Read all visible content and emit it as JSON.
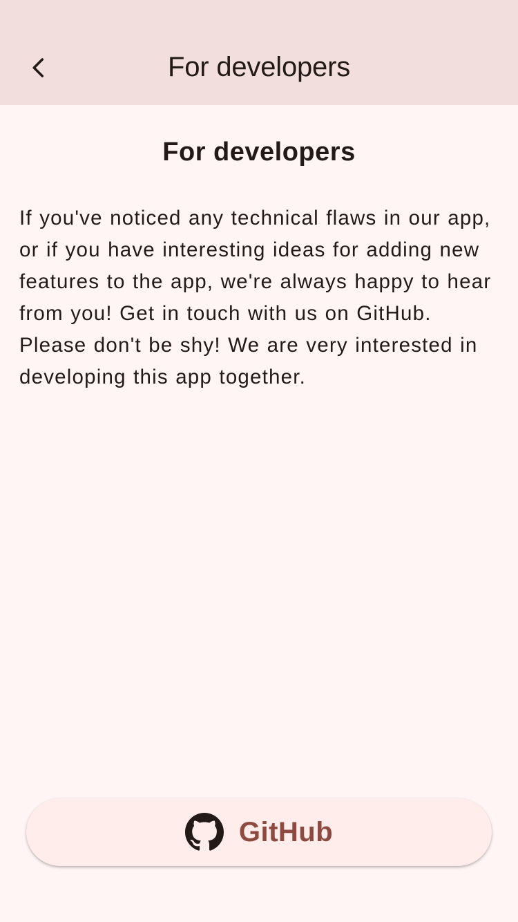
{
  "app_bar": {
    "title": "For developers",
    "back_icon": "chevron-left-icon"
  },
  "main": {
    "heading": "For developers",
    "paragraph": "If you've noticed any technical flaws in our app, or if you have interesting ideas for adding new features to the app, we're always happy to hear from you! Get in touch with us on GitHub. Please don't be shy! We are very interested in developing this app together."
  },
  "github_button": {
    "label": "GitHub",
    "icon": "github-icon"
  },
  "colors": {
    "app_bar_bg": "#F2DEDD",
    "page_bg": "#FFF5F4",
    "text": "#231917",
    "button_bg": "#FEEDEB",
    "button_text": "#8F4A40"
  }
}
